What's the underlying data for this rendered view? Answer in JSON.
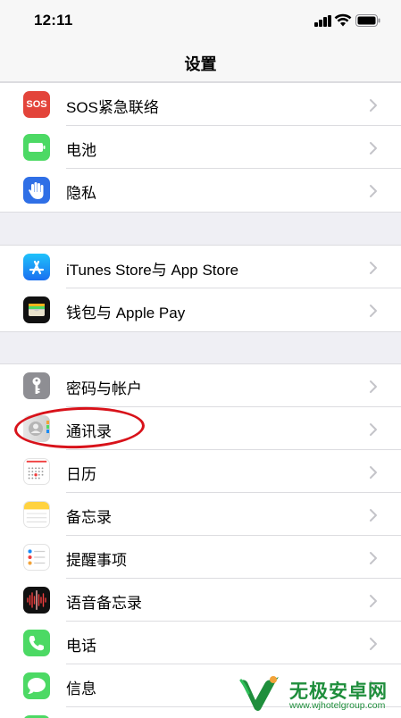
{
  "status_bar": {
    "time": "12:11"
  },
  "nav": {
    "title": "设置"
  },
  "groups": [
    {
      "items": [
        {
          "label": "SOS紧急联络",
          "icon": "sos-icon",
          "icon_text": "SOS",
          "color": "#e3443a"
        },
        {
          "label": "电池",
          "icon": "battery-icon",
          "color": "#4cd964"
        },
        {
          "label": "隐私",
          "icon": "hand-icon",
          "color": "#2f6fe6"
        }
      ]
    },
    {
      "items": [
        {
          "label": "iTunes Store与 App Store",
          "icon": "app-store-icon",
          "color": "#1a8bf5"
        },
        {
          "label": "钱包与 Apple Pay",
          "icon": "wallet-icon",
          "color": "#111111"
        }
      ]
    },
    {
      "items": [
        {
          "label": "密码与帐户",
          "icon": "key-icon",
          "color": "#8e8e93"
        },
        {
          "label": "通讯录",
          "icon": "contacts-icon",
          "color": "#d9d9d9"
        },
        {
          "label": "日历",
          "icon": "calendar-icon",
          "color": "#ffffff"
        },
        {
          "label": "备忘录",
          "icon": "notes-icon",
          "color": "#ffffff"
        },
        {
          "label": "提醒事项",
          "icon": "reminders-icon",
          "color": "#ffffff"
        },
        {
          "label": "语音备忘录",
          "icon": "voice-memos-icon",
          "color": "#111111"
        },
        {
          "label": "电话",
          "icon": "phone-icon",
          "color": "#4cd964"
        },
        {
          "label": "信息",
          "icon": "messages-icon",
          "color": "#4cd964"
        },
        {
          "label": "",
          "icon": "facetime-icon",
          "color": "#4cd964"
        }
      ]
    }
  ],
  "watermark": {
    "title": "无极安卓网",
    "url": "www.wjhotelgroup.com"
  },
  "colors": {
    "highlight": "#d8121a",
    "watermark": "#1f8e3c"
  }
}
